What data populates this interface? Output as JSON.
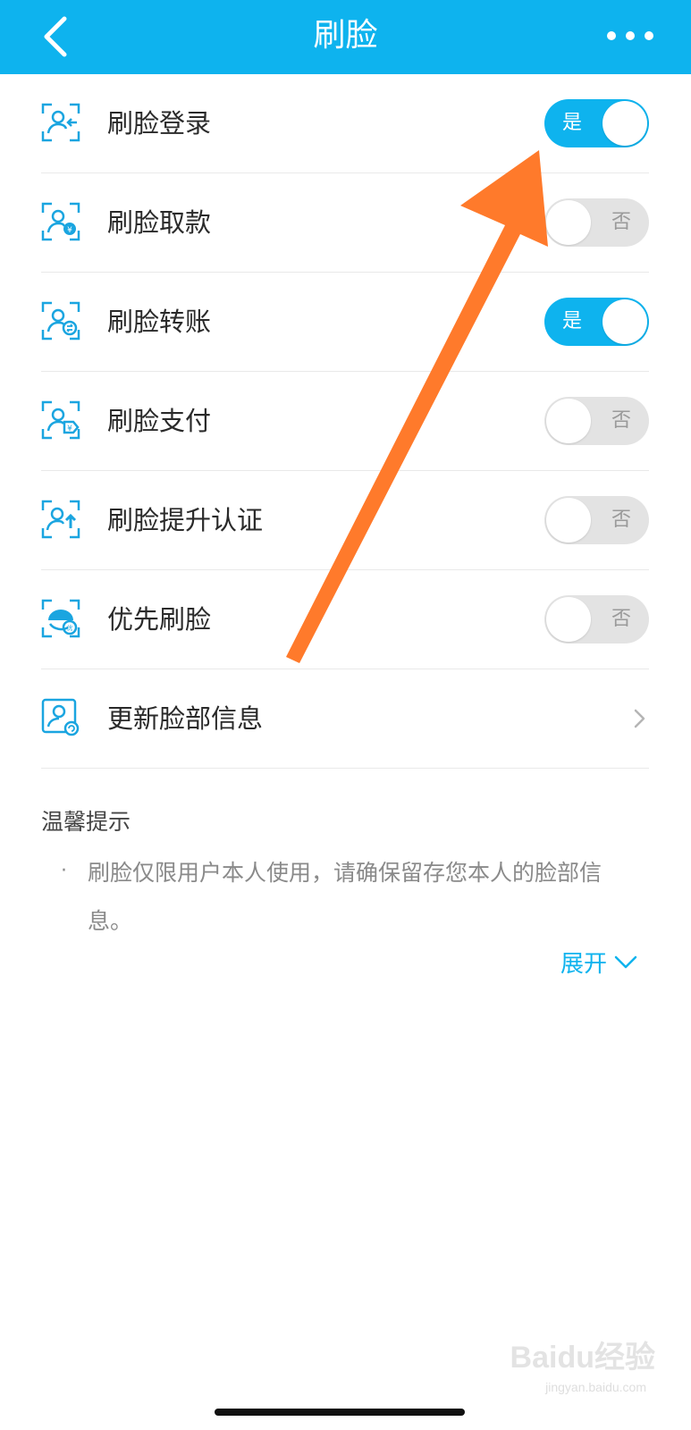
{
  "nav": {
    "title": "刷脸",
    "back_icon": "chevron-left-icon",
    "more_icon": "more-dots-icon",
    "bg": "#0eb3ee"
  },
  "rows": [
    {
      "label": "刷脸登录",
      "icon": "face-login-icon",
      "state": "on",
      "toggle_text": "是"
    },
    {
      "label": "刷脸取款",
      "icon": "face-withdraw-icon",
      "state": "off",
      "toggle_text": "否"
    },
    {
      "label": "刷脸转账",
      "icon": "face-transfer-icon",
      "state": "on",
      "toggle_text": "是"
    },
    {
      "label": "刷脸支付",
      "icon": "face-pay-icon",
      "state": "off",
      "toggle_text": "否"
    },
    {
      "label": "刷脸提升认证",
      "icon": "face-upgrade-icon",
      "state": "off",
      "toggle_text": "否"
    },
    {
      "label": "优先刷脸",
      "icon": "face-priority-icon",
      "state": "off",
      "toggle_text": "否"
    },
    {
      "label": "更新脸部信息",
      "icon": "face-update-icon",
      "chevron": true
    }
  ],
  "tips": {
    "title": "温馨提示",
    "bullet": "·",
    "body": "刷脸仅限用户本人使用，请确保留存您本人的脸部信息。",
    "expand_label": "展开"
  },
  "watermark": {
    "text": "Baidu经验",
    "sub": "jingyan.baidu.com"
  },
  "colors": {
    "accent": "#0eb3ee",
    "annotation_arrow": "#ff7a2b"
  }
}
